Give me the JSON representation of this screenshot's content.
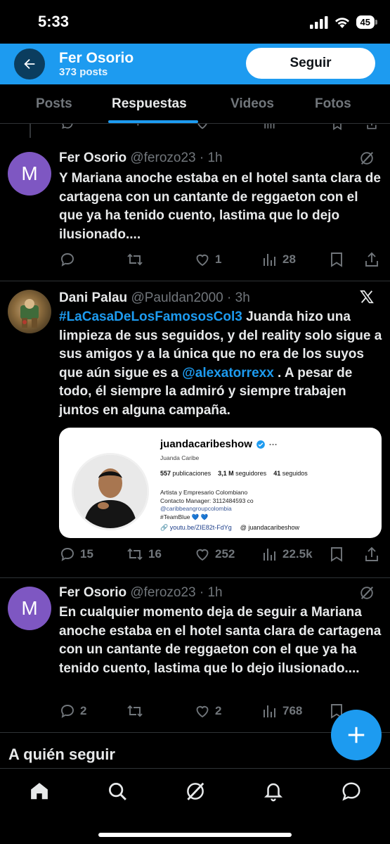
{
  "status_bar": {
    "time": "5:33",
    "battery": "45"
  },
  "header": {
    "name": "Fer Osorio",
    "posts": "373 posts",
    "follow_label": "Seguir"
  },
  "tabs": [
    {
      "label": "Posts"
    },
    {
      "label": "Respuestas"
    },
    {
      "label": "Videos"
    },
    {
      "label": "Fotos"
    }
  ],
  "active_tab": "Respuestas",
  "tweets": [
    {
      "avatar_letter": "M",
      "name": "Fer Osorio",
      "handle": "@ferozo23",
      "time": "· 1h",
      "text": "Y Mariana anoche estaba en el hotel santa clara de cartagena con un cantante de reggaeton con el que ya ha tenido cuento, lastima que lo dejo ilusionado....",
      "replies": "",
      "reposts": "",
      "likes": "1",
      "views": "28"
    },
    {
      "name": "Dani Palau",
      "handle": "@Pauldan2000",
      "time": "· 3h",
      "hashtag": "#LaCasaDeLosFamososCol3",
      "text_1": " Juanda hizo una limpieza de sus seguidos, y del reality solo sigue a sus amigos y a la única que no era de los suyos que aún sigue es a ",
      "mention": "@alexatorrexx",
      "text_2": " . A pesar de todo, él siempre la admiró y siempre trabajen juntos en alguna campaña.",
      "replies": "15",
      "reposts": "16",
      "likes": "252",
      "views": "22.5k",
      "card": {
        "username": "juandacaribeshow",
        "display_name": "Juanda Caribe",
        "posts": "557",
        "posts_label": "publicaciones",
        "followers": "3,1 M",
        "followers_label": "seguidores",
        "following": "41",
        "following_label": "seguidos",
        "bio_1": "Artista y Empresario Colombiano",
        "bio_2": "Contacto Manager: 3112484593 co",
        "bio_3": "@caribbeangroupcolombia",
        "bio_4": "#TeamBlue 💙 💙",
        "link": "youtu.be/ZIE82t-FdYg",
        "threads": "juandacaribeshow"
      }
    },
    {
      "avatar_letter": "M",
      "name": "Fer Osorio",
      "handle": "@ferozo23",
      "time": "· 1h",
      "text": "En cualquier momento deja de seguir a Mariana anoche estaba en el hotel santa clara de cartagena con un cantante de reggaeton con el que ya ha tenido cuento, lastima que lo dejo ilusionado....",
      "replies": "2",
      "reposts": "",
      "likes": "2",
      "views": "768"
    }
  ],
  "who_to_follow": "A quién seguir",
  "colors": {
    "accent": "#1d9bf0",
    "background": "#000000",
    "muted": "#71767b",
    "text": "#e7e9ea"
  },
  "icons": [
    "back-arrow-icon",
    "grok-icon",
    "x-logo-icon",
    "reply-icon",
    "repost-icon",
    "like-icon",
    "views-icon",
    "bookmark-icon",
    "share-icon",
    "plus-icon",
    "home-icon",
    "search-icon",
    "notifications-icon",
    "messages-icon"
  ]
}
